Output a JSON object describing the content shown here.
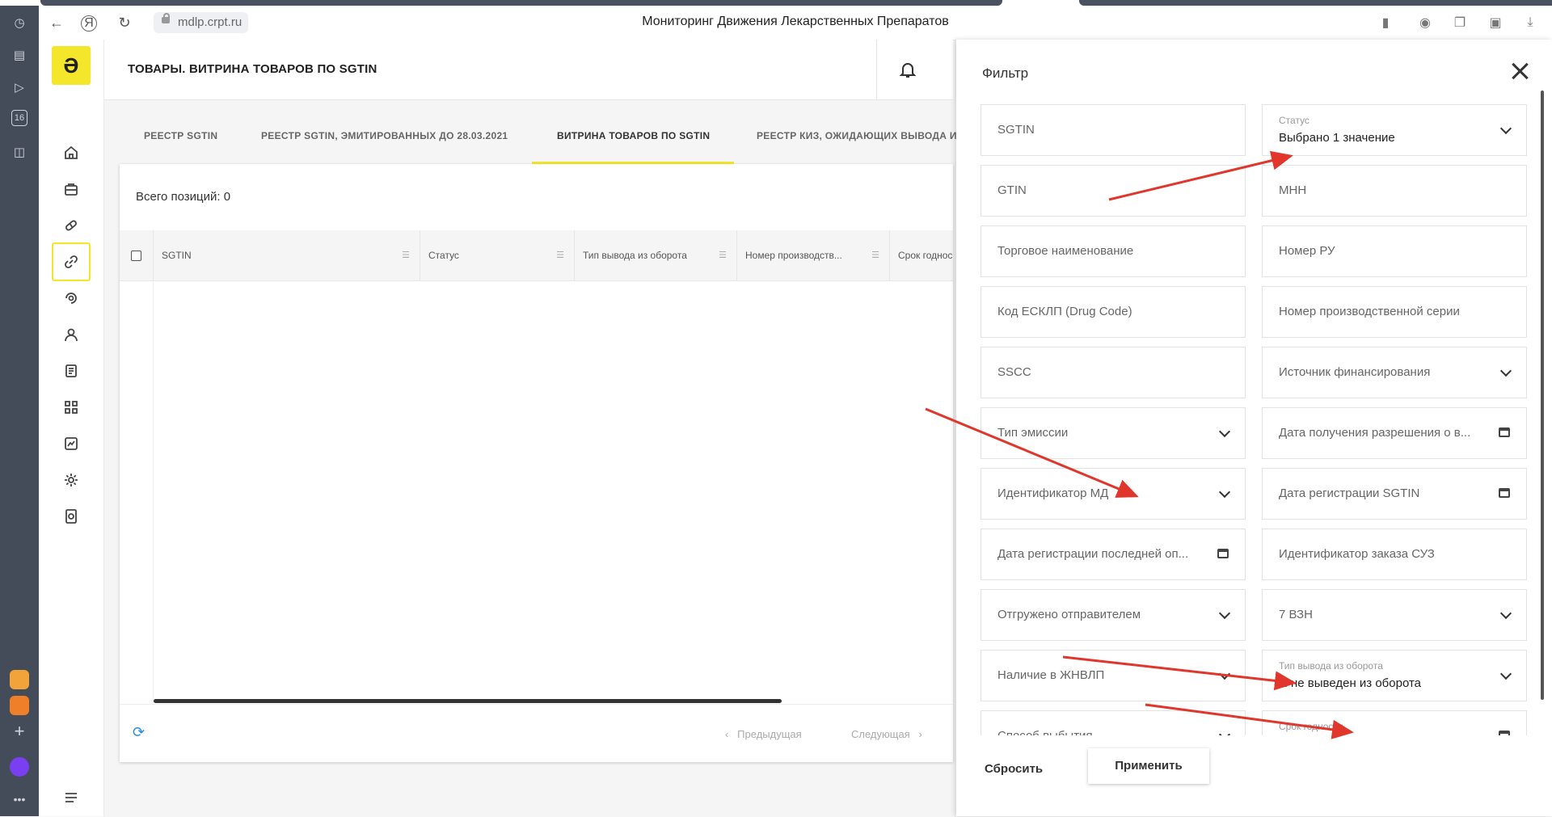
{
  "browser": {
    "url": "mdlp.crpt.ru",
    "page_title": "Мониторинг Движения Лекарственных Препаратов",
    "side_badge": "16"
  },
  "header": {
    "title": "ТОВАРЫ. ВИТРИНА ТОВАРОВ ПО SGTIN"
  },
  "tabs": [
    {
      "label": "РЕЕСТР SGTIN"
    },
    {
      "label": "РЕЕСТР SGTIN, ЭМИТИРОВАННЫХ ДО 28.03.2021"
    },
    {
      "label": "ВИТРИНА ТОВАРОВ ПО SGTIN"
    },
    {
      "label": "РЕЕСТР КИЗ, ОЖИДАЮЩИХ ВЫВОДА И"
    }
  ],
  "table": {
    "count_label": "Всего позиций: 0",
    "columns": [
      "SGTIN",
      "Статус",
      "Тип вывода из оборота",
      "Номер производств...",
      "Срок годнос"
    ],
    "prev_label": "Предыдущая",
    "next_label": "Следующая"
  },
  "filter": {
    "title": "Фильтр",
    "left": [
      {
        "label": "SGTIN"
      },
      {
        "label": "GTIN"
      },
      {
        "label": "Торговое наименование"
      },
      {
        "label": "Код ЕСКЛП (Drug Code)"
      },
      {
        "label": "SSCC"
      },
      {
        "label": "Тип эмиссии"
      },
      {
        "label": "Идентификатор МД"
      },
      {
        "label": "Дата регистрации последней оп..."
      },
      {
        "label": "Отгружено отправителем"
      },
      {
        "label": "Наличие в ЖНВЛП"
      },
      {
        "label": "Способ выбытия"
      }
    ],
    "right": [
      {
        "small": "Статус",
        "value": "Выбрано 1 значение"
      },
      {
        "label": "МНН"
      },
      {
        "label": "Номер РУ"
      },
      {
        "label": "Номер производственной серии"
      },
      {
        "label": "Источник финансирования"
      },
      {
        "label": "Дата получения разрешения о в..."
      },
      {
        "label": "Дата регистрации SGTIN"
      },
      {
        "label": "Идентификатор заказа СУЗ"
      },
      {
        "label": "7 ВЗН"
      },
      {
        "small": "Тип вывода из оборота",
        "value": "Я не выведен из оборота"
      },
      {
        "small": "Срок годности"
      }
    ],
    "reset_label": "Сбросить",
    "apply_label": "Применить"
  },
  "colors": {
    "accent": "#f4e62b",
    "arrow": "#e0362c",
    "refresh": "#2a8ce0"
  }
}
